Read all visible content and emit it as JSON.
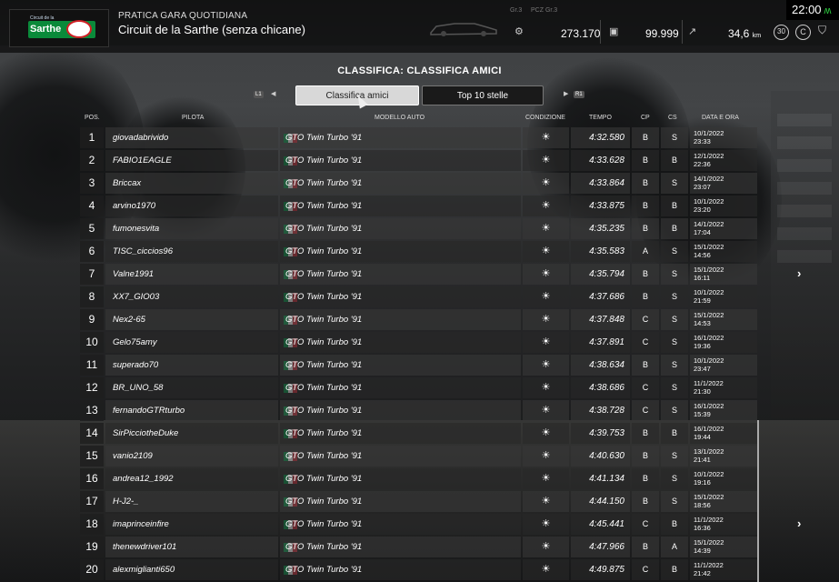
{
  "header": {
    "event_type": "PRATICA GARA QUOTIDIANA",
    "track": "Circuit de la Sarthe (senza chicane)",
    "logo_text": "Sarthe",
    "logo_small": "Circuit de la",
    "car_class": "Gr.3",
    "bop_tag": "PCZ Gr.3",
    "stat1": "273.170",
    "stat2": "99.999",
    "distance": "34,6",
    "distance_unit": "km",
    "laps_badge": "30",
    "badge_c": "C",
    "clock": "22:00"
  },
  "leaderboard": {
    "title": "CLASSIFICA: CLASSIFICA AMICI",
    "tabs": [
      "Classifica amici",
      "Top 10 stelle"
    ],
    "nav_left": "L1",
    "nav_right": "R1",
    "columns": {
      "pos": "POS.",
      "pilota": "PILOTA",
      "modello": "MODELLO AUTO",
      "condizione": "CONDIZIONE",
      "tempo": "TEMPO",
      "cp": "CP",
      "cs": "CS",
      "data": "DATA E ORA"
    },
    "rows": [
      {
        "pos": "1",
        "driver": "giovadabrivido",
        "car": "GTO Twin Turbo '91",
        "time": "4:32.580",
        "cp": "B",
        "cs": "S",
        "date": "10/1/2022",
        "hour": "23:33"
      },
      {
        "pos": "2",
        "driver": "FABIO1EAGLE",
        "car": "GTO Twin Turbo '91",
        "time": "4:33.628",
        "cp": "B",
        "cs": "B",
        "date": "12/1/2022",
        "hour": "22:36"
      },
      {
        "pos": "3",
        "driver": "Briccax",
        "car": "GTO Twin Turbo '91",
        "time": "4:33.864",
        "cp": "B",
        "cs": "S",
        "date": "14/1/2022",
        "hour": "23:07"
      },
      {
        "pos": "4",
        "driver": "arvino1970",
        "car": "GTO Twin Turbo '91",
        "time": "4:33.875",
        "cp": "B",
        "cs": "B",
        "date": "10/1/2022",
        "hour": "23:20"
      },
      {
        "pos": "5",
        "driver": "fumonesvita",
        "car": "GTO Twin Turbo '91",
        "time": "4:35.235",
        "cp": "B",
        "cs": "B",
        "date": "14/1/2022",
        "hour": "17:04"
      },
      {
        "pos": "6",
        "driver": "TISC_ciccios96",
        "car": "GTO Twin Turbo '91",
        "time": "4:35.583",
        "cp": "A",
        "cs": "S",
        "date": "15/1/2022",
        "hour": "14:56"
      },
      {
        "pos": "7",
        "driver": "Valne1991",
        "car": "GTO Twin Turbo '91",
        "time": "4:35.794",
        "cp": "B",
        "cs": "S",
        "date": "15/1/2022",
        "hour": "16:11"
      },
      {
        "pos": "8",
        "driver": "XX7_GIO03",
        "car": "GTO Twin Turbo '91",
        "time": "4:37.686",
        "cp": "B",
        "cs": "S",
        "date": "10/1/2022",
        "hour": "21:59"
      },
      {
        "pos": "9",
        "driver": "Nex2-65",
        "car": "GTO Twin Turbo '91",
        "time": "4:37.848",
        "cp": "C",
        "cs": "S",
        "date": "15/1/2022",
        "hour": "14:53"
      },
      {
        "pos": "10",
        "driver": "Gelo75amy",
        "car": "GTO Twin Turbo '91",
        "time": "4:37.891",
        "cp": "C",
        "cs": "S",
        "date": "16/1/2022",
        "hour": "19:36"
      },
      {
        "pos": "11",
        "driver": "superado70",
        "car": "GTO Twin Turbo '91",
        "time": "4:38.634",
        "cp": "B",
        "cs": "S",
        "date": "10/1/2022",
        "hour": "23:47"
      },
      {
        "pos": "12",
        "driver": "BR_UNO_58",
        "car": "GTO Twin Turbo '91",
        "time": "4:38.686",
        "cp": "C",
        "cs": "S",
        "date": "11/1/2022",
        "hour": "21:30"
      },
      {
        "pos": "13",
        "driver": "fernandoGTRturbo",
        "car": "GTO Twin Turbo '91",
        "time": "4:38.728",
        "cp": "C",
        "cs": "S",
        "date": "16/1/2022",
        "hour": "15:39"
      },
      {
        "pos": "14",
        "driver": "SirPicciotheDuke",
        "car": "GTO Twin Turbo '91",
        "time": "4:39.753",
        "cp": "B",
        "cs": "B",
        "date": "16/1/2022",
        "hour": "19:44"
      },
      {
        "pos": "15",
        "driver": "vanio2109",
        "car": "GTO Twin Turbo '91",
        "time": "4:40.630",
        "cp": "B",
        "cs": "S",
        "date": "13/1/2022",
        "hour": "21:41"
      },
      {
        "pos": "16",
        "driver": "andrea12_1992",
        "car": "GTO Twin Turbo '91",
        "time": "4:41.134",
        "cp": "B",
        "cs": "S",
        "date": "10/1/2022",
        "hour": "19:16"
      },
      {
        "pos": "17",
        "driver": "H-J2-_",
        "car": "GTO Twin Turbo '91",
        "time": "4:44.150",
        "cp": "B",
        "cs": "S",
        "date": "15/1/2022",
        "hour": "18:56"
      },
      {
        "pos": "18",
        "driver": "imaprinceinfire",
        "car": "GTO Twin Turbo '91",
        "time": "4:45.441",
        "cp": "C",
        "cs": "B",
        "date": "11/1/2022",
        "hour": "16:36"
      },
      {
        "pos": "19",
        "driver": "thenewdriver101",
        "car": "GTO Twin Turbo '91",
        "time": "4:47.966",
        "cp": "B",
        "cs": "A",
        "date": "15/1/2022",
        "hour": "14:39"
      },
      {
        "pos": "20",
        "driver": "alexmiglianti650",
        "car": "GTO Twin Turbo '91",
        "time": "4:49.875",
        "cp": "C",
        "cs": "B",
        "date": "11/1/2022",
        "hour": "21:42"
      }
    ]
  },
  "icons": {
    "condition": "sun-icon",
    "flag": "italy-flag-icon",
    "next": "chevron-right-icon"
  },
  "colors": {
    "clock_accent": "#2ecc40",
    "tab_active_bg": "#d8d8d8"
  }
}
